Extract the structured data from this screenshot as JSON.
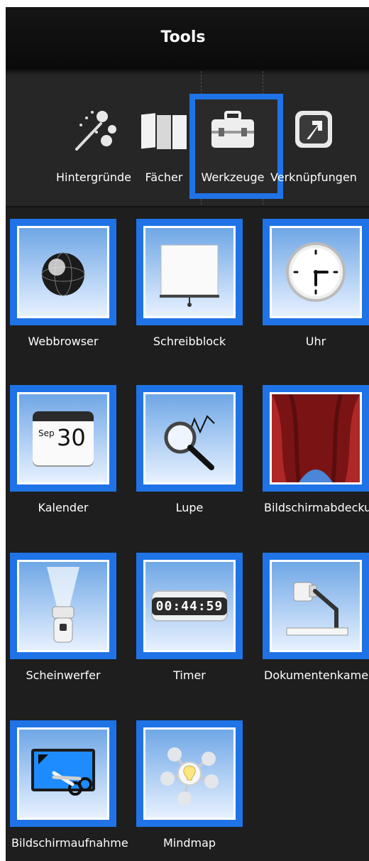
{
  "panel": {
    "title": "Tools"
  },
  "tabs": [
    {
      "label": "Hintergründe",
      "icon": "paint-brush-icon",
      "active": false
    },
    {
      "label": "Fächer",
      "icon": "folders-icon",
      "active": false
    },
    {
      "label": "Werkzeuge",
      "icon": "toolbox-icon",
      "active": true
    },
    {
      "label": "Verknüpfungen",
      "icon": "shortcut-arrow-icon",
      "active": false
    }
  ],
  "tools": [
    {
      "label": "Webbrowser",
      "icon": "globe-icon"
    },
    {
      "label": "Schreibblock",
      "icon": "whiteboard-icon"
    },
    {
      "label": "Uhr",
      "icon": "clock-icon"
    },
    {
      "label": "Kalender",
      "icon": "calendar-icon",
      "calendar_month": "Sep",
      "calendar_day": "30"
    },
    {
      "label": "Lupe",
      "icon": "magnifier-icon"
    },
    {
      "label": "Bildschirmabdeckung",
      "icon": "curtain-icon"
    },
    {
      "label": "Scheinwerfer",
      "icon": "flashlight-icon"
    },
    {
      "label": "Timer",
      "icon": "timer-icon",
      "timer_value": "00:44:59"
    },
    {
      "label": "Dokumentenkamera",
      "icon": "document-camera-icon"
    },
    {
      "label": "Bildschirmaufnahme",
      "icon": "screen-capture-icon"
    },
    {
      "label": "Mindmap",
      "icon": "mindmap-icon"
    }
  ],
  "colors": {
    "accent": "#1f73e6",
    "panel_bg": "#1e1e1e",
    "text": "#ffffff"
  }
}
